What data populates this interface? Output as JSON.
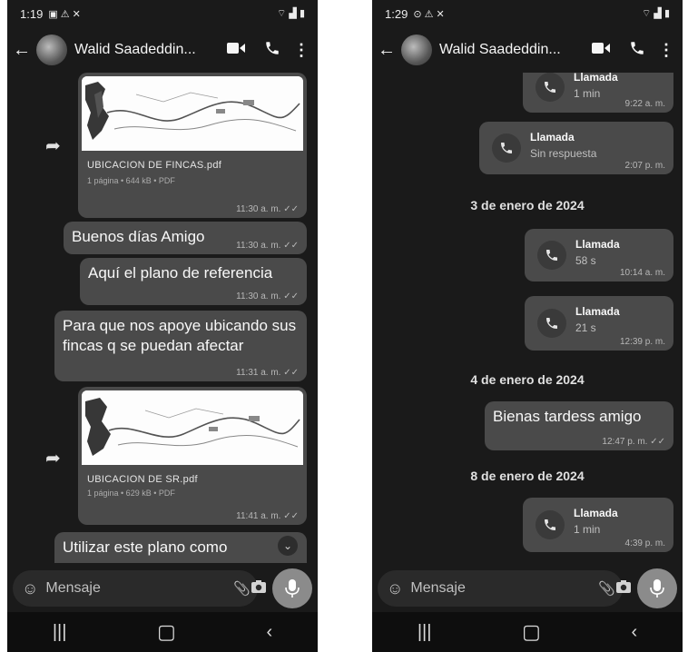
{
  "left": {
    "status": {
      "time": "1:19",
      "icons_left": "▣ ⚠ ✕",
      "icons_right": "⌔ ▟ ▮"
    },
    "header": {
      "contact": "Walid Saadeddin..."
    },
    "messages": {
      "doc1": {
        "name": "UBICACION DE FINCAS.pdf",
        "info": "1 página • 644 kB • PDF",
        "time": "11:30 a. m. ✓✓"
      },
      "m1": {
        "text": "Buenos días Amigo",
        "time": "11:30 a. m. ✓✓"
      },
      "m2": {
        "text": "Aquí el plano de referencia",
        "time": "11:30 a. m. ✓✓"
      },
      "m3": {
        "text": "Para que nos apoye ubicando sus fincas q se puedan afectar",
        "time": "11:31 a. m. ✓✓"
      },
      "doc2": {
        "name": "UBICACION DE SR.pdf",
        "info": "1 página • 629 kB • PDF",
        "time": "11:41 a. m. ✓✓"
      },
      "m4": {
        "text": "Utilizar este plano como"
      }
    },
    "input": {
      "placeholder": "Mensaje"
    }
  },
  "right": {
    "status": {
      "time": "1:29",
      "icons_left": "⊙ ⚠ ✕",
      "icons_right": "⌔ ▟ ▮"
    },
    "header": {
      "contact": "Walid Saadeddin..."
    },
    "messages": {
      "call0": {
        "title": "Llamada",
        "sub": "1 min",
        "time": "9:22 a. m."
      },
      "call1": {
        "title": "Llamada",
        "sub": "Sin respuesta",
        "time": "2:07 p. m."
      },
      "date1": "3 de enero de 2024",
      "call2": {
        "title": "Llamada",
        "sub": "58 s",
        "time": "10:14 a. m."
      },
      "call3": {
        "title": "Llamada",
        "sub": "21 s",
        "time": "12:39 p. m."
      },
      "date2": "4 de enero de 2024",
      "m1": {
        "text": "Bienas tardess amigo",
        "time": "12:47 p. m. ✓✓"
      },
      "date3": "8 de enero de 2024",
      "call4": {
        "title": "Llamada",
        "sub": "1 min",
        "time": "4:39 p. m."
      }
    },
    "input": {
      "placeholder": "Mensaje"
    }
  },
  "icons": {
    "back": "back-arrow-icon",
    "video": "video-call-icon",
    "phone": "phone-icon",
    "menu": "more-vert-icon",
    "forward": "forward-icon",
    "emoji": "emoji-icon",
    "attach": "attach-icon",
    "camera": "camera-icon",
    "mic": "mic-icon",
    "recent": "recent-apps-icon",
    "home": "home-icon",
    "nav_back": "nav-back-icon",
    "call": "call-icon",
    "scroll": "scroll-down-icon"
  }
}
